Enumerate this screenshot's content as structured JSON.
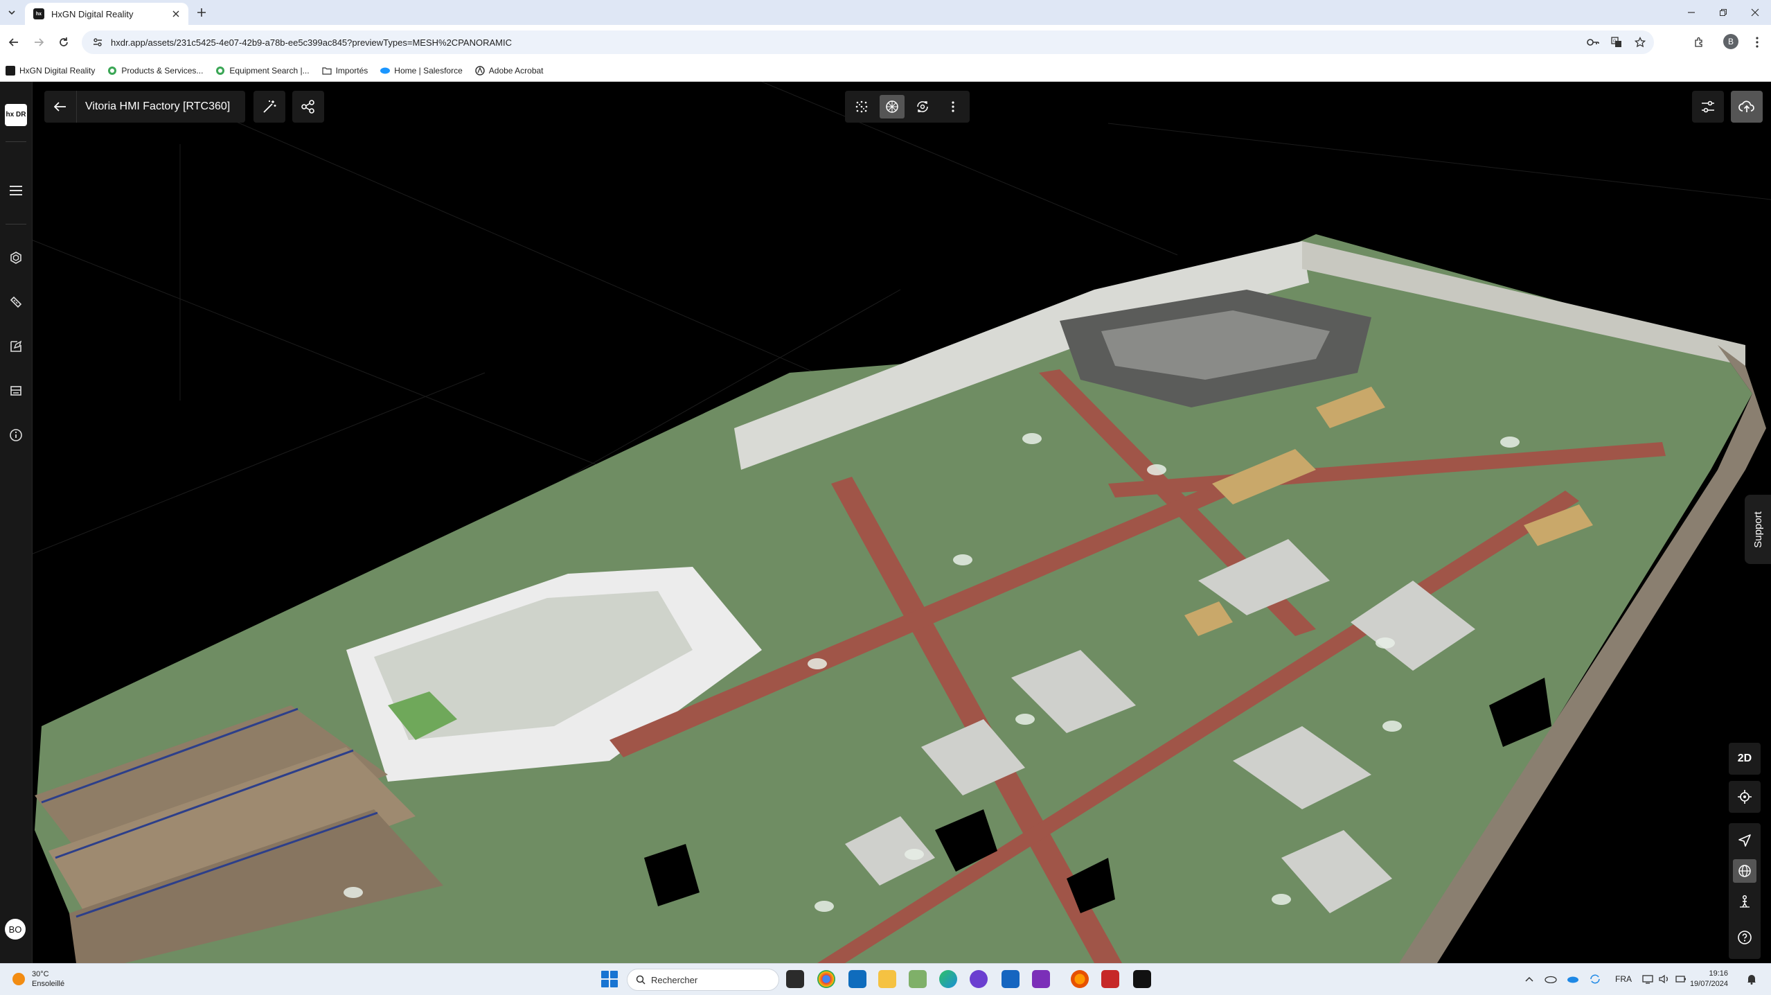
{
  "browser": {
    "tab": {
      "title": "HxGN Digital Reality",
      "favicon": "hxdr-logo"
    },
    "url": "hxdr.app/assets/231c5425-4e07-42b9-a78b-ee5c399ac845?previewTypes=MESH%2CPANORAMIC",
    "profile_initial": "B",
    "bookmarks": [
      {
        "label": "HxGN Digital Reality",
        "icon": "hxdr-logo"
      },
      {
        "label": "Products & Services...",
        "icon": "globe-green"
      },
      {
        "label": "Equipment Search |...",
        "icon": "globe-green"
      },
      {
        "label": "Importés",
        "icon": "folder"
      },
      {
        "label": "Home | Salesforce",
        "icon": "salesforce-cloud"
      },
      {
        "label": "Adobe Acrobat",
        "icon": "acrobat"
      }
    ]
  },
  "app": {
    "logo_text": "hx DR",
    "asset_title": "Vitoria HMI Factory [RTC360]",
    "left_rail": [
      "menu-icon",
      "layers-icon",
      "measure-icon",
      "annotate-icon",
      "cards-icon",
      "info-icon"
    ],
    "user_initials": "BO",
    "view_modes": [
      "point-cloud-icon",
      "mesh-icon",
      "panorama-icon",
      "more-icon"
    ],
    "active_view_mode": "mesh-icon",
    "right_tools": [
      "2D",
      "compass-icon",
      "navigate-icon",
      "globe-icon",
      "person-icon",
      "help-icon"
    ],
    "support_label": "Support",
    "colors": {
      "panel": "#1b1b1b",
      "active": "#555555",
      "floor_green": "#7a9a6e",
      "walkway_red": "#a05548"
    }
  },
  "taskbar": {
    "temperature": "30°C",
    "weather_desc": "Ensoleillé",
    "search_placeholder": "Rechercher",
    "language": "FRA",
    "time": "19:16",
    "date": "19/07/2024"
  }
}
